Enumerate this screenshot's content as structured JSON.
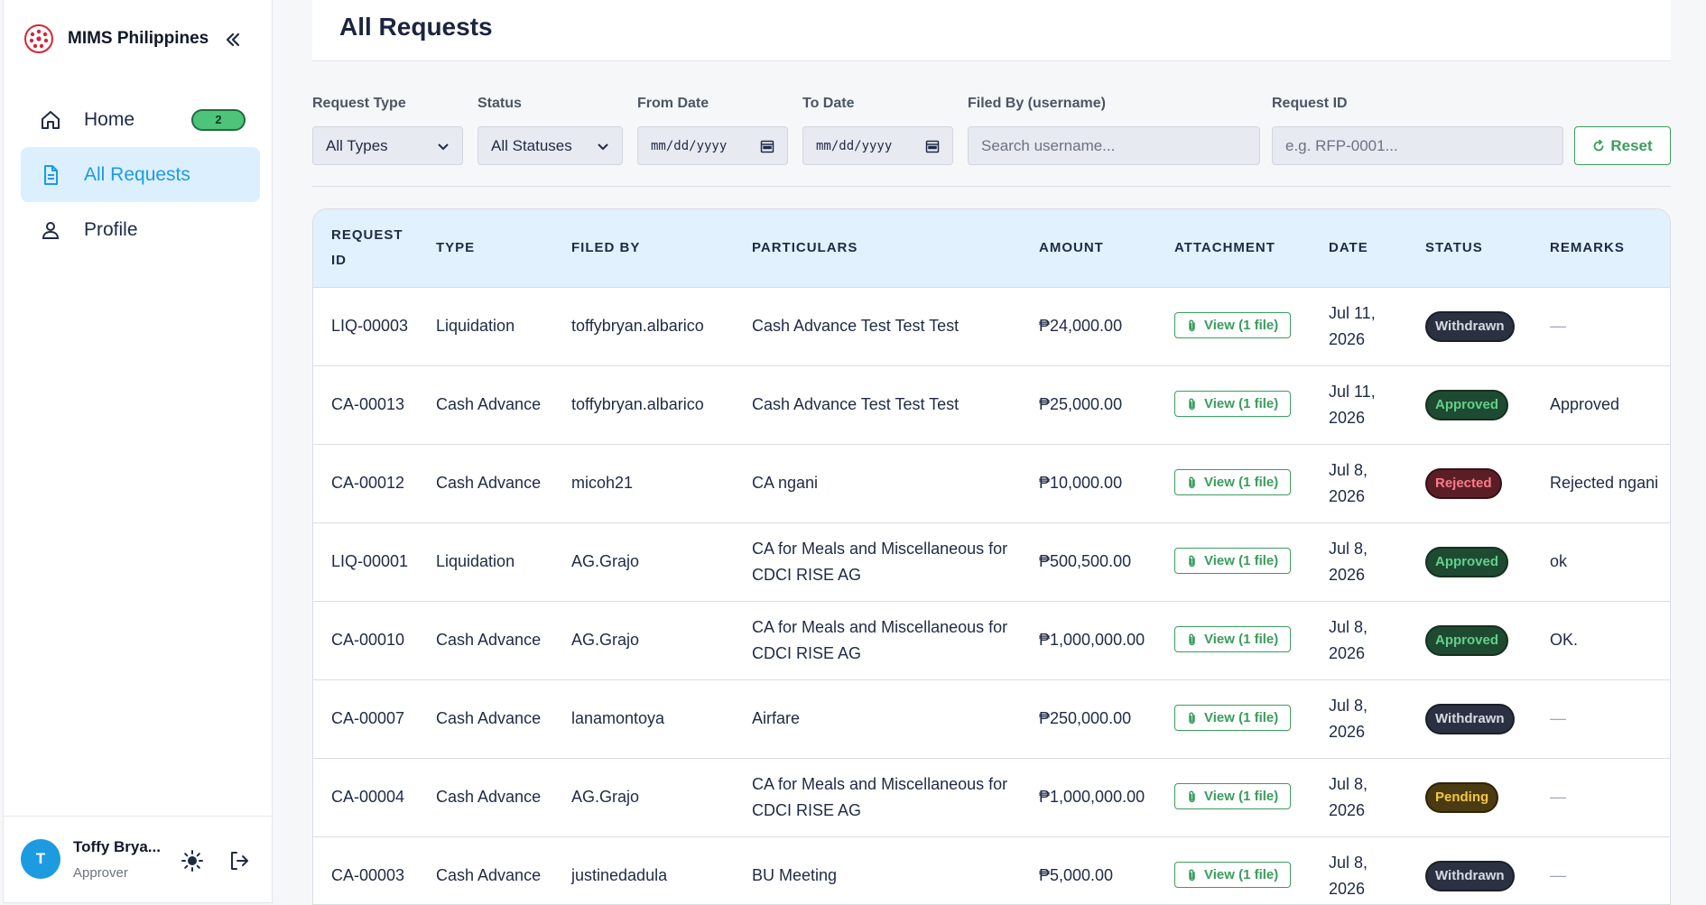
{
  "app": {
    "brand_name": "MIMS Philippines",
    "accent_color": "#1d9be0",
    "success_color": "#3a9d5d"
  },
  "sidebar": {
    "items": [
      {
        "label": "Home",
        "icon": "home-icon",
        "badge": "2"
      },
      {
        "label": "All Requests",
        "icon": "document-icon",
        "active": true
      },
      {
        "label": "Profile",
        "icon": "user-icon"
      }
    ],
    "user": {
      "initial": "T",
      "name": "Toffy Brya...",
      "role": "Approver"
    }
  },
  "page": {
    "title": "All Requests"
  },
  "filters": {
    "request_type": {
      "label": "Request Type",
      "value": "All Types"
    },
    "status": {
      "label": "Status",
      "value": "All Statuses"
    },
    "from_date": {
      "label": "From Date",
      "placeholder": "mm/dd/yyyy"
    },
    "to_date": {
      "label": "To Date",
      "placeholder": "mm/dd/yyyy"
    },
    "filed_by": {
      "label": "Filed By (username)",
      "placeholder": "Search username..."
    },
    "request_id": {
      "label": "Request ID",
      "placeholder": "e.g. RFP-0001..."
    },
    "reset_label": "Reset"
  },
  "table": {
    "columns": [
      "REQUEST ID",
      "TYPE",
      "FILED BY",
      "PARTICULARS",
      "AMOUNT",
      "ATTACHMENT",
      "DATE",
      "STATUS",
      "REMARKS"
    ],
    "rows": [
      {
        "id": "LIQ-00003",
        "type": "Liquidation",
        "filed_by": "toffybryan.albarico",
        "particulars": "Cash Advance Test Test Test",
        "amount": "₱24,000.00",
        "attachment": "View (1 file)",
        "date": "Jul 11, 2026",
        "status": "Withdrawn",
        "remarks": "—"
      },
      {
        "id": "CA-00013",
        "type": "Cash Advance",
        "filed_by": "toffybryan.albarico",
        "particulars": "Cash Advance Test Test Test",
        "amount": "₱25,000.00",
        "attachment": "View (1 file)",
        "date": "Jul 11, 2026",
        "status": "Approved",
        "remarks": "Approved"
      },
      {
        "id": "CA-00012",
        "type": "Cash Advance",
        "filed_by": "micoh21",
        "particulars": "CA ngani",
        "amount": "₱10,000.00",
        "attachment": "View (1 file)",
        "date": "Jul 8, 2026",
        "status": "Rejected",
        "remarks": "Rejected ngani"
      },
      {
        "id": "LIQ-00001",
        "type": "Liquidation",
        "filed_by": "AG.Grajo",
        "particulars": "CA for Meals and Miscellaneous for CDCI RISE AG",
        "amount": "₱500,500.00",
        "attachment": "View (1 file)",
        "date": "Jul 8, 2026",
        "status": "Approved",
        "remarks": "ok"
      },
      {
        "id": "CA-00010",
        "type": "Cash Advance",
        "filed_by": "AG.Grajo",
        "particulars": "CA for Meals and Miscellaneous for CDCI RISE AG",
        "amount": "₱1,000,000.00",
        "attachment": "View (1 file)",
        "date": "Jul 8, 2026",
        "status": "Approved",
        "remarks": "OK."
      },
      {
        "id": "CA-00007",
        "type": "Cash Advance",
        "filed_by": "lanamontoya",
        "particulars": "Airfare",
        "amount": "₱250,000.00",
        "attachment": "View (1 file)",
        "date": "Jul 8, 2026",
        "status": "Withdrawn",
        "remarks": "—"
      },
      {
        "id": "CA-00004",
        "type": "Cash Advance",
        "filed_by": "AG.Grajo",
        "particulars": "CA for Meals and Miscellaneous for CDCI RISE AG",
        "amount": "₱1,000,000.00",
        "attachment": "View (1 file)",
        "date": "Jul 8, 2026",
        "status": "Pending",
        "remarks": "—"
      },
      {
        "id": "CA-00003",
        "type": "Cash Advance",
        "filed_by": "justinedadula",
        "particulars": "BU Meeting",
        "amount": "₱5,000.00",
        "attachment": "View (1 file)",
        "date": "Jul 8, 2026",
        "status": "Withdrawn",
        "remarks": "—"
      }
    ]
  }
}
